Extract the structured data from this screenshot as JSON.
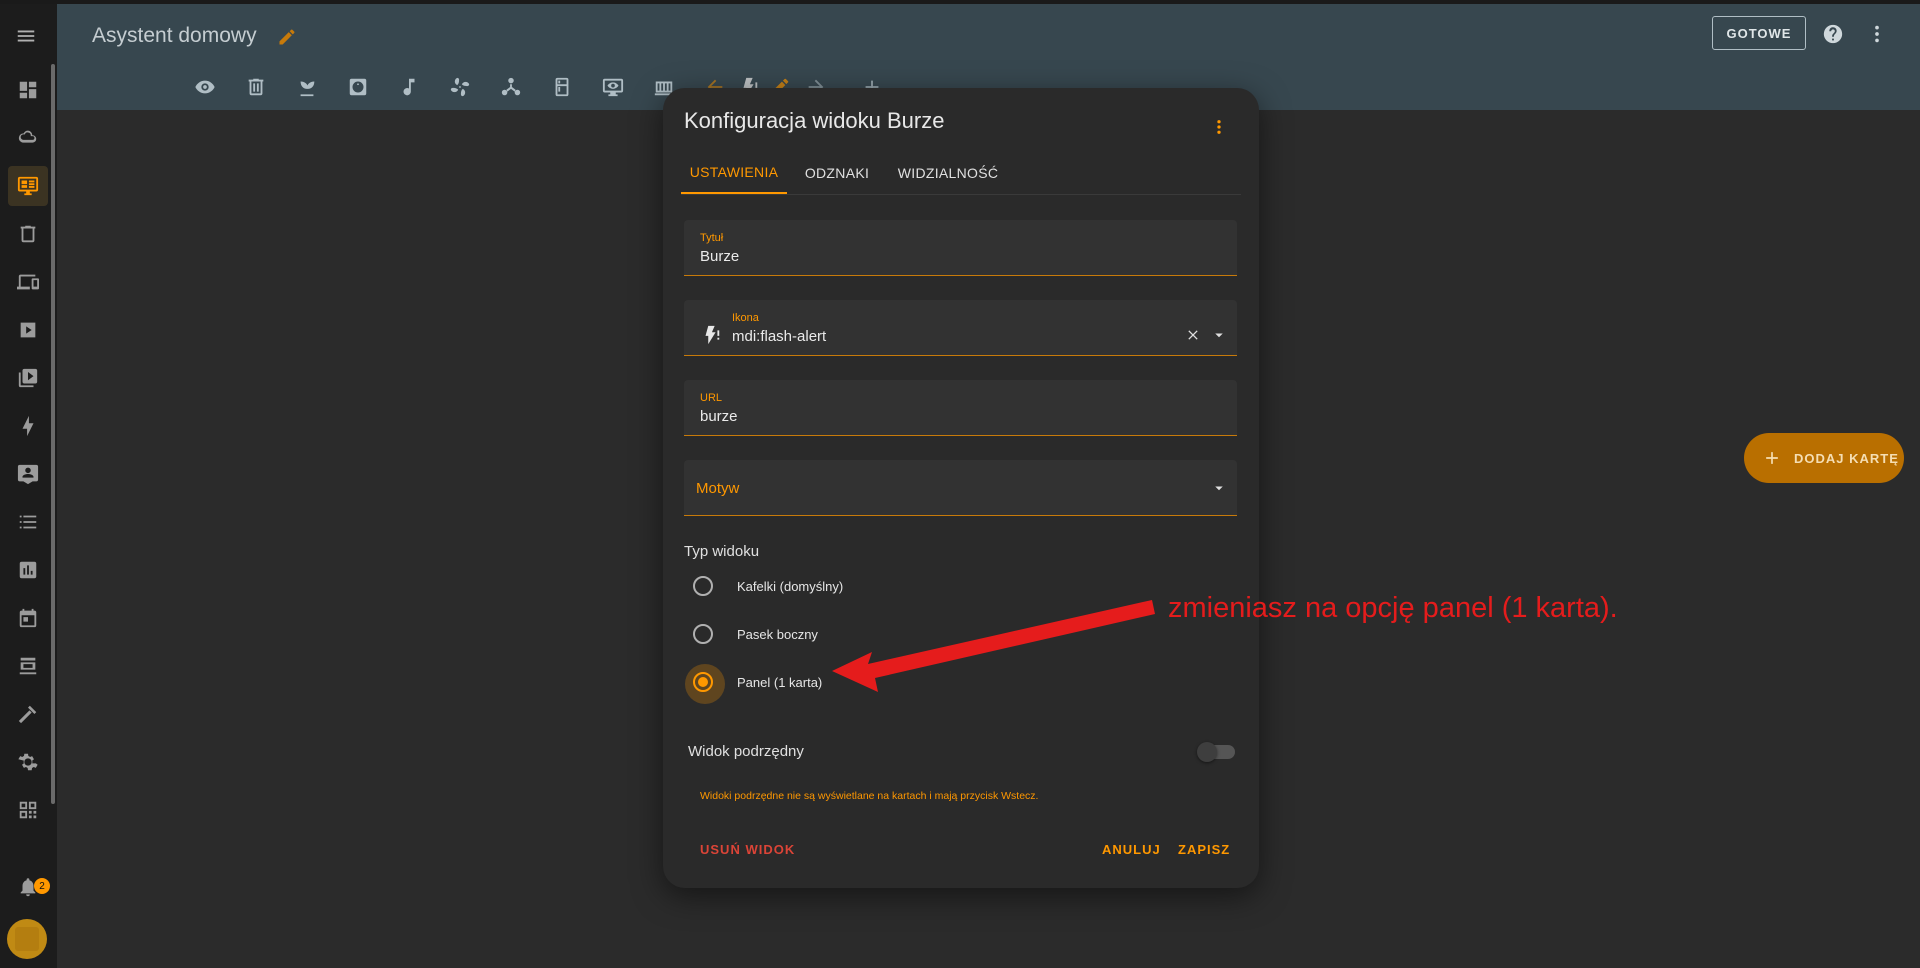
{
  "header": {
    "title": "Asystent domowy",
    "done_label": "GOTOWE"
  },
  "sidebar": {
    "items": [
      "dashboard-icon",
      "weather-icon",
      "monitor-icon",
      "trash-icon",
      "devices-icon",
      "play-icon",
      "media-icon",
      "energy-icon",
      "person-icon",
      "list-icon",
      "chart-icon",
      "calendar-icon",
      "hacs-icon",
      "hammer-icon",
      "settings-icon",
      "qrcode-icon"
    ],
    "active": "monitor-icon",
    "notification_count": "2"
  },
  "view_tabs": [
    "eye-icon",
    "trash-icon",
    "plant-icon",
    "robot-vacuum-icon",
    "music-icon",
    "fan-icon",
    "hub-icon",
    "fridge-icon",
    "monitor-eye-icon",
    "radiator-icon",
    "arrow-left-icon",
    "flash-alert-icon",
    "pencil-icon",
    "arrow-right-icon",
    "plus-icon"
  ],
  "fab": {
    "label": "DODAJ KARTĘ"
  },
  "dialog": {
    "title": "Konfiguracja widoku Burze",
    "tabs": [
      "USTAWIENIA",
      "ODZNAKI",
      "WIDZIALNOŚĆ"
    ],
    "active_tab": "USTAWIENIA",
    "fields": {
      "title": {
        "label": "Tytuł",
        "value": "Burze"
      },
      "icon": {
        "label": "Ikona",
        "value": "mdi:flash-alert"
      },
      "url": {
        "label": "URL",
        "value": "burze"
      },
      "theme": {
        "label": "Motyw"
      }
    },
    "view_type": {
      "label": "Typ widoku",
      "options": [
        "Kafelki (domyślny)",
        "Pasek boczny",
        "Panel (1 karta)"
      ],
      "selected": "Panel (1 karta)"
    },
    "subview": {
      "label": "Widok podrzędny",
      "enabled": false,
      "hint": "Widoki podrzędne nie są wyświetlane na kartach i mają przycisk Wstecz."
    },
    "buttons": {
      "delete": "USUŃ WIDOK",
      "cancel": "ANULUJ",
      "save": "ZAPISZ"
    }
  },
  "annotation": {
    "text": "zmieniasz na opcję panel (1 karta)."
  },
  "colors": {
    "accent": "#ff9800",
    "header": "#37474f",
    "annotation": "#e51c1c"
  }
}
